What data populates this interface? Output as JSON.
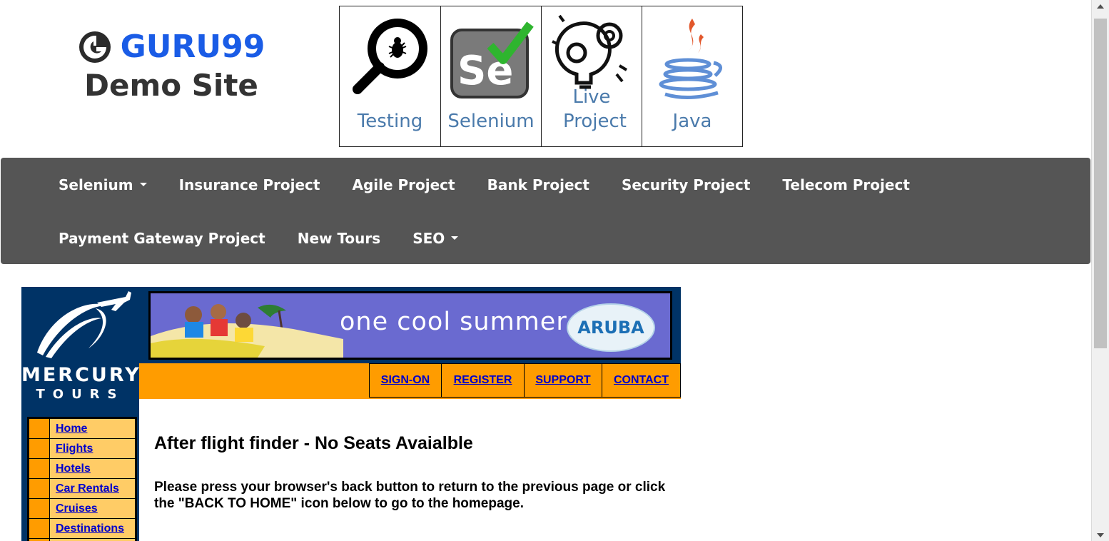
{
  "header": {
    "brand_name": "GURU99",
    "brand_subtitle": "Demo Site",
    "tiles": [
      {
        "label": "Testing",
        "icon": "magnifier-bug-icon"
      },
      {
        "label": "Selenium",
        "icon": "selenium-logo-icon"
      },
      {
        "label": "Live Project",
        "icon": "lightbulb-gears-icon"
      },
      {
        "label": "Java",
        "icon": "java-cup-icon"
      }
    ]
  },
  "nav": {
    "row1": [
      "Selenium",
      "Insurance Project",
      "Agile Project",
      "Bank Project",
      "Security Project",
      "Telecom Project"
    ],
    "row2": [
      "Payment Gateway Project",
      "New Tours",
      "SEO"
    ]
  },
  "mercury": {
    "logo_line1": "MERCURY",
    "logo_line2": "TOURS",
    "banner_text": "one cool summer",
    "banner_badge": "ARUBA",
    "topnav": [
      "SIGN-ON",
      "REGISTER",
      "SUPPORT",
      "CONTACT"
    ],
    "side_menu": [
      "Home",
      "Flights",
      "Hotels",
      "Car Rentals",
      "Cruises",
      "Destinations"
    ],
    "heading": "After flight finder - No Seats Avaialble",
    "message": "Please press your browser's back button to return to the previous page or click the \"BACK TO HOME\" icon below to go to the homepage."
  },
  "colors": {
    "brand_blue": "#1a5ce6",
    "nav_bg": "#555555",
    "mercury_navy": "#003366",
    "mercury_orange": "#ff9c00",
    "mercury_menu": "#ffcc66",
    "link_blue": "#0000cc"
  }
}
